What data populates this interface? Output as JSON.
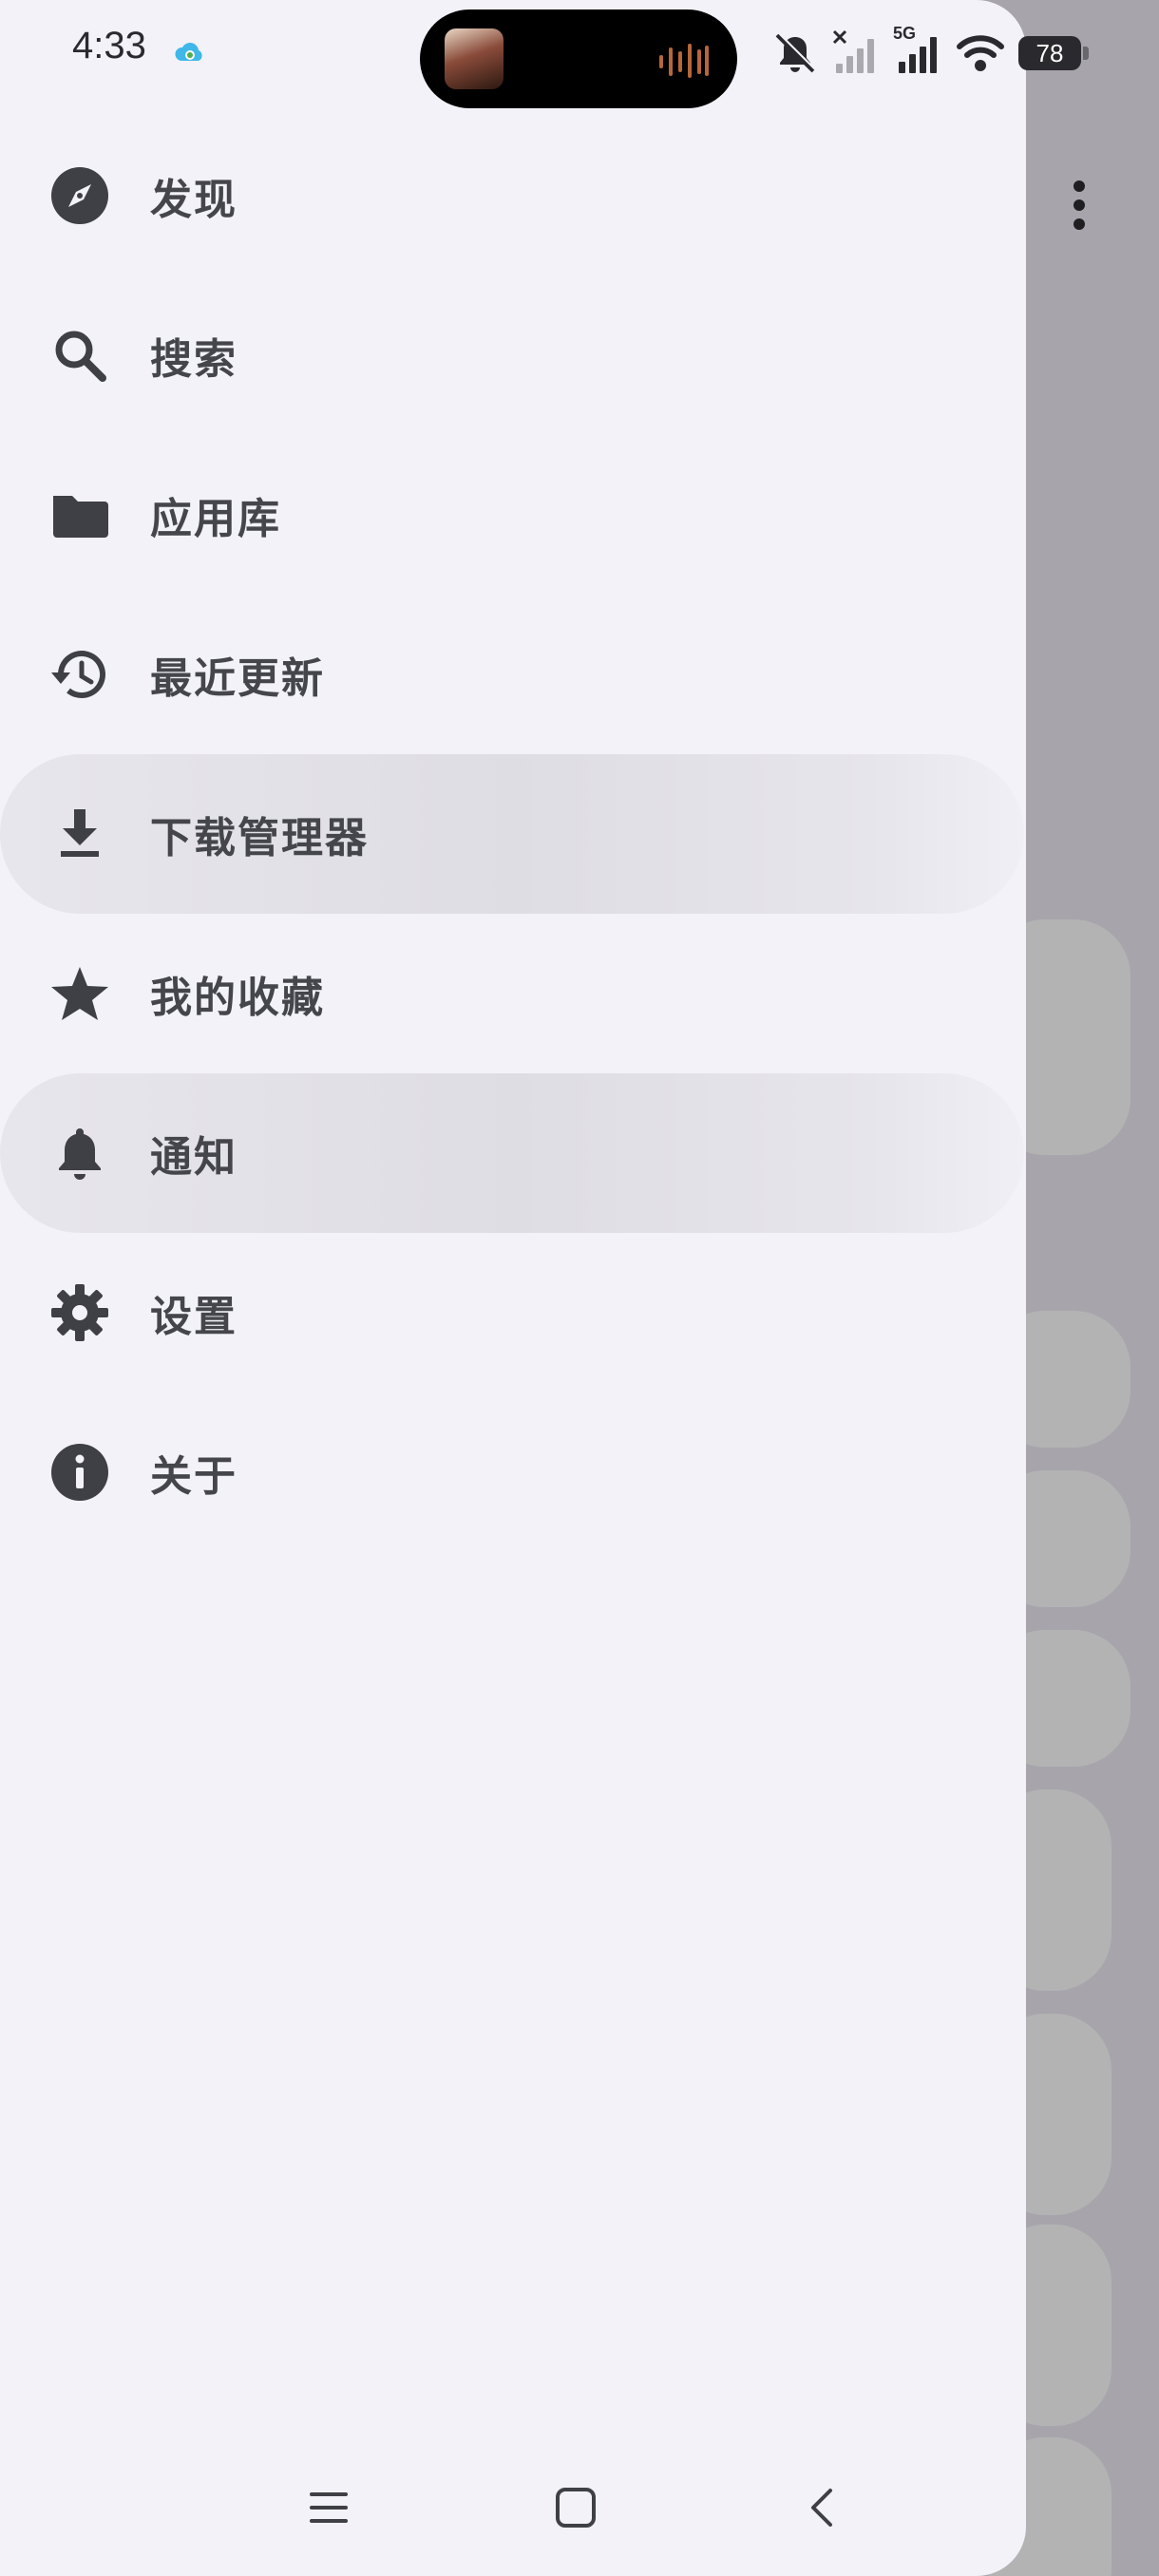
{
  "status_bar": {
    "time": "4:33",
    "network_type": "5G",
    "battery_level": "78"
  },
  "drawer": {
    "items": [
      {
        "label": "发现",
        "icon": "compass-icon"
      },
      {
        "label": "搜索",
        "icon": "search-icon"
      },
      {
        "label": "应用库",
        "icon": "folder-icon"
      },
      {
        "label": "最近更新",
        "icon": "history-icon"
      },
      {
        "label": "下载管理器",
        "icon": "download-icon"
      },
      {
        "label": "我的收藏",
        "icon": "star-icon"
      },
      {
        "label": "通知",
        "icon": "bell-icon"
      },
      {
        "label": "设置",
        "icon": "gear-icon"
      },
      {
        "label": "关于",
        "icon": "info-icon"
      }
    ]
  },
  "colors": {
    "drawer_bg": "#f3f2f8",
    "text": "#45454c",
    "icon": "#3f3f46",
    "highlight": "#dedde3",
    "scrim": "#a7a5ab"
  },
  "nav_bar": {
    "buttons": [
      "menu-icon",
      "home-square-icon",
      "back-chevron-icon"
    ]
  }
}
